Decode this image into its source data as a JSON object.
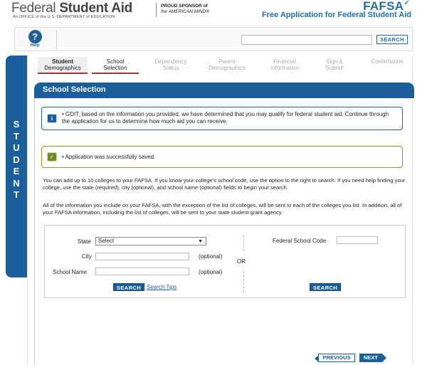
{
  "header": {
    "fsa_name_light": "Federal ",
    "fsa_name_bold": "Student Aid",
    "fsa_subtitle": "An OFFICE of the U.S. DEPARTMENT of EDUCATION",
    "sponsor_line1": "PROUD SPONSOR of",
    "sponsor_line2": "the AMERICAN MIND®",
    "fafsa_logo": "FAFSA",
    "fafsa_tagline": "Free Application for Federal Student Aid"
  },
  "topbar": {
    "help_label": "Help",
    "help_symbol": "?",
    "search_placeholder": "",
    "search_button": "SEARCH"
  },
  "side_tab": {
    "letters": [
      "S",
      "T",
      "U",
      "D",
      "E",
      "N",
      "T"
    ]
  },
  "steps": [
    {
      "line1": "Student",
      "line2": "Demographics",
      "state": "done"
    },
    {
      "line1": "School",
      "line2": "Selection",
      "state": "active"
    },
    {
      "line1": "Dependency",
      "line2": "Status",
      "state": "future"
    },
    {
      "line1": "Parent",
      "line2": "Demographics",
      "state": "future"
    },
    {
      "line1": "Financial",
      "line2": "Information",
      "state": "future"
    },
    {
      "line1": "Sign &",
      "line2": "Submit",
      "state": "future"
    },
    {
      "line1": "Confirmation",
      "line2": "",
      "state": "future"
    }
  ],
  "section": {
    "title": "School Selection"
  },
  "alerts": {
    "info_icon": "i",
    "info_text": "• GDIT, based on the information you provided, we have determined that you may qualify for federal student aid. Continue through the application for us to determine how much aid you can receive.",
    "success_icon": "✓",
    "success_text": "• Application was successfully saved."
  },
  "paragraphs": {
    "p1": "You can add up to 10 colleges to your FAFSA. If you know your college's school code, use the option to the right to search. If you need help finding your college, use the state (required), city (optional), and school name (optional) fields to begin your search.",
    "p2": "All of the information you include on your FAFSA, with the exception of the list of colleges, will be sent to each of the colleges you list. In addition, all of your FAFSA information, including the list of colleges, will be sent to your state student grant agency."
  },
  "search_form": {
    "state_label": "State",
    "state_value": "Select",
    "city_label": "City",
    "city_value": "",
    "city_optional": "(optional)",
    "school_label": "School Name",
    "school_value": "",
    "school_optional": "(optional)",
    "or_text": "OR",
    "search_button": "SEARCH",
    "tips_link": "Search Tips",
    "code_label": "Federal School Code",
    "code_value": "",
    "code_search_button": "SEARCH"
  },
  "footer": {
    "previous": "PREVIOUS",
    "next": "NEXT"
  },
  "colors": {
    "brand_blue": "#1a5f9c",
    "fafsa_blue": "#1f6fa8",
    "fafsa_green": "#3aa35c",
    "step_underline": "#b03030",
    "success_border": "#8a9c2a"
  }
}
